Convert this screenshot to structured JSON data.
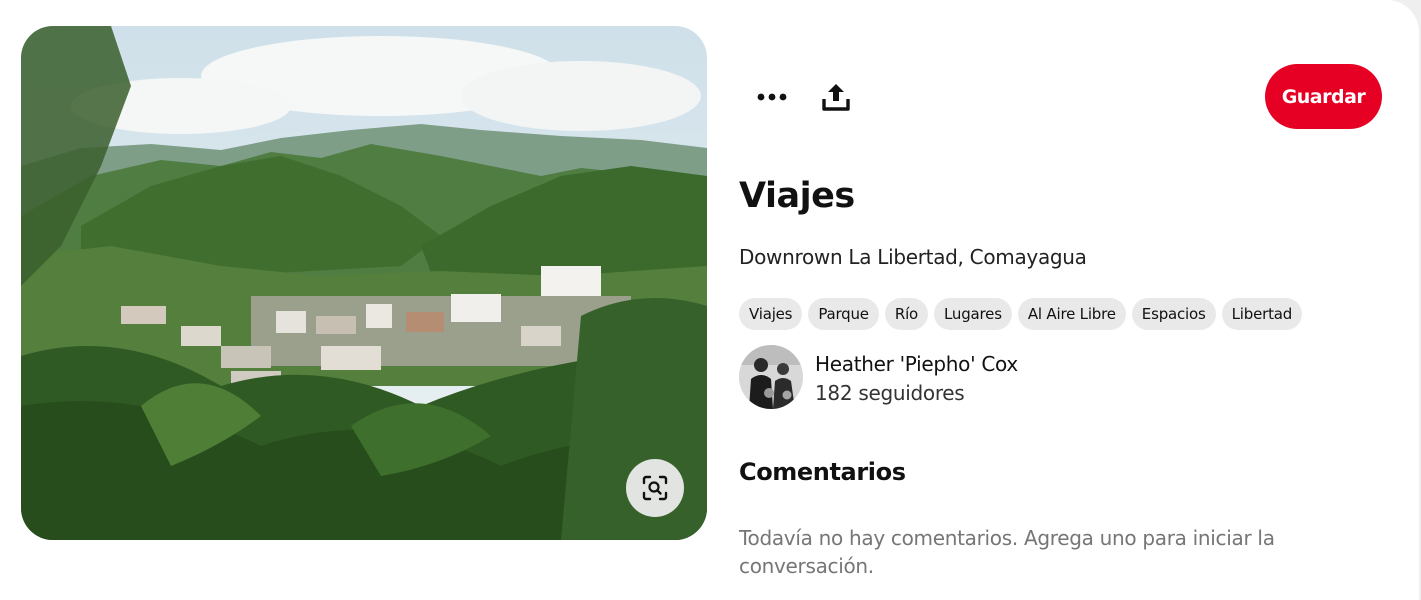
{
  "pin": {
    "title": "Viajes",
    "description": "Downrown La Libertad, Comayagua",
    "tags": [
      "Viajes",
      "Parque",
      "Río",
      "Lugares",
      "Al Aire Libre",
      "Espacios",
      "Libertad"
    ]
  },
  "toolbar": {
    "more_icon": "more-horizontal-icon",
    "share_icon": "share-upload-icon",
    "save_label": "Guardar"
  },
  "creator": {
    "name": "Heather 'Piepho' Cox",
    "followers": "182 seguidores"
  },
  "comments": {
    "title": "Comentarios",
    "empty_text": "Todavía no hay comentarios. Agrega uno para iniciar la conversación."
  },
  "image": {
    "lens_icon": "visual-search-icon"
  },
  "colors": {
    "save_button": "#e60023",
    "tag_background": "#e9e9e9",
    "muted_text": "#767676"
  }
}
